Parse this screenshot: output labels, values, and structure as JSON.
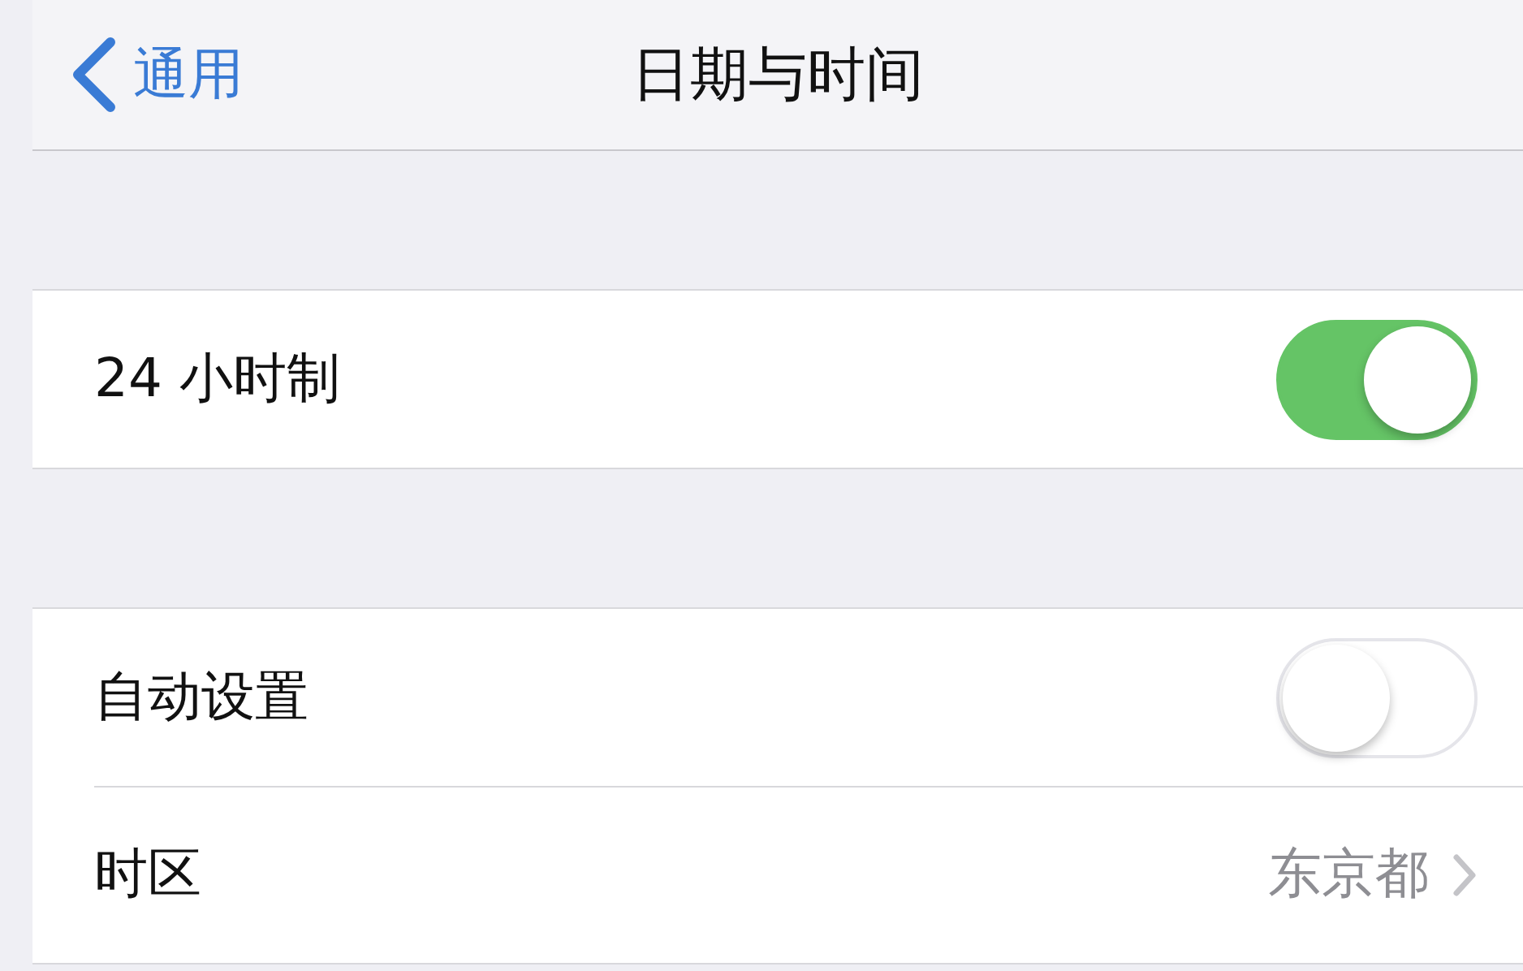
{
  "nav": {
    "back_label": "通用",
    "title": "日期与时间"
  },
  "sections": [
    {
      "rows": [
        {
          "kind": "toggle",
          "label": "24 小时制",
          "on": true
        }
      ]
    },
    {
      "rows": [
        {
          "kind": "toggle",
          "label": "自动设置",
          "on": false
        },
        {
          "kind": "link",
          "label": "时区",
          "value": "东京都"
        }
      ]
    }
  ]
}
